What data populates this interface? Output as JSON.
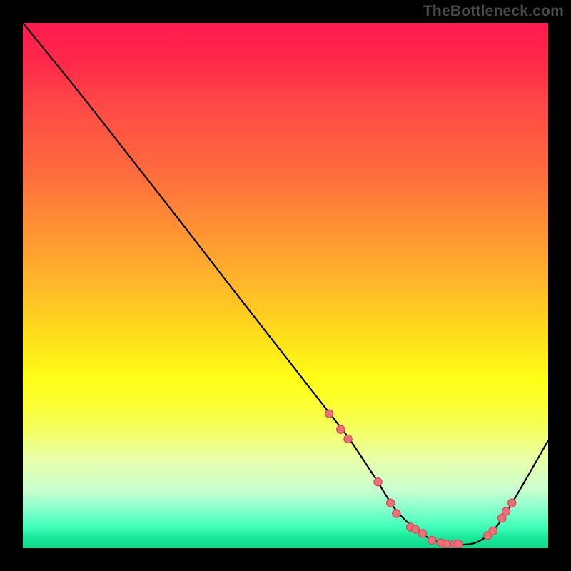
{
  "watermark": {
    "text": "TheBottleneck.com"
  },
  "colors": {
    "dot_fill": "#ee6f78",
    "dot_stroke": "#c9525c",
    "curve": "#000000",
    "background": "#000000"
  },
  "chart_data": {
    "type": "line",
    "title": "",
    "xlabel": "",
    "ylabel": "",
    "xlim": [
      0,
      100
    ],
    "ylim": [
      0,
      100
    ],
    "grid": false,
    "legend": false,
    "note": "No axes, ticks, or labels are rendered in the image; values are read as relative percentages of the plot area. y is plotted with origin at bottom.",
    "series": [
      {
        "name": "bottleneck-curve",
        "x": [
          0.0,
          3.1,
          5.2,
          10.3,
          20.6,
          31.0,
          41.2,
          51.6,
          57.2,
          59.4,
          62.5,
          67.0,
          71.4,
          76.8,
          81.2,
          84.3,
          87.0,
          90.0,
          92.9,
          96.4,
          100.0
        ],
        "y": [
          100.0,
          96.2,
          93.6,
          87.3,
          74.2,
          60.9,
          47.7,
          34.4,
          27.2,
          24.4,
          20.3,
          13.5,
          6.8,
          2.2,
          0.8,
          0.7,
          1.4,
          3.9,
          8.2,
          14.2,
          20.5
        ]
      }
    ],
    "markers": [
      {
        "x": 58.3,
        "y": 25.6
      },
      {
        "x": 60.5,
        "y": 22.6
      },
      {
        "x": 61.9,
        "y": 20.8
      },
      {
        "x": 67.6,
        "y": 12.6
      },
      {
        "x": 70.0,
        "y": 8.6
      },
      {
        "x": 71.1,
        "y": 6.6
      },
      {
        "x": 73.8,
        "y": 4.0
      },
      {
        "x": 74.7,
        "y": 3.6
      },
      {
        "x": 76.1,
        "y": 2.8
      },
      {
        "x": 77.9,
        "y": 1.5
      },
      {
        "x": 79.6,
        "y": 1.0
      },
      {
        "x": 80.7,
        "y": 0.8
      },
      {
        "x": 82.2,
        "y": 0.8
      },
      {
        "x": 82.9,
        "y": 0.8
      },
      {
        "x": 88.5,
        "y": 2.4
      },
      {
        "x": 89.5,
        "y": 3.3
      },
      {
        "x": 91.2,
        "y": 5.7
      },
      {
        "x": 92.0,
        "y": 7.0
      },
      {
        "x": 93.1,
        "y": 8.6
      }
    ]
  }
}
